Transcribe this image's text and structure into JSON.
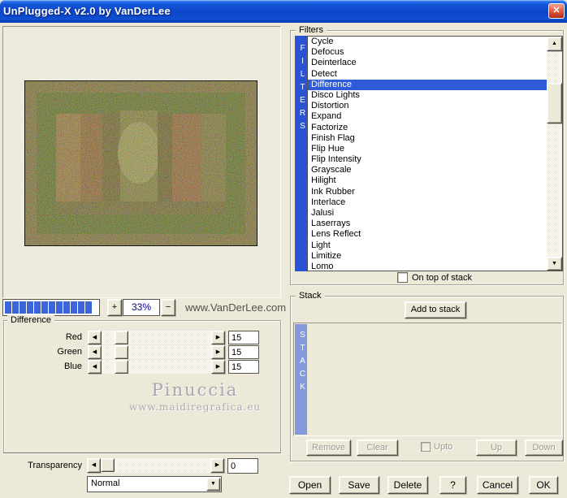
{
  "window": {
    "title": "UnPlugged-X v2.0 by VanDerLee"
  },
  "icons": {
    "close": "✕",
    "left_arrow": "◀",
    "right_arrow": "▶",
    "up_arrow": "▲",
    "down_arrow": "▼",
    "dropdown_arrow": "▼"
  },
  "preview": {
    "zoom_in": "+",
    "zoom_out": "−",
    "zoom_level": "33%",
    "website": "www.VanDerLee.com"
  },
  "filters": {
    "group_label": "Filters",
    "side_label": "FILTERS",
    "selected": "Difference",
    "items": [
      "Cycle",
      "Defocus",
      "Deinterlace",
      "Detect",
      "Difference",
      "Disco Lights",
      "Distortion",
      "Expand",
      "Factorize",
      "Finish Flag",
      "Flip Hue",
      "Flip Intensity",
      "Grayscale",
      "Hilight",
      "Ink Rubber",
      "Interlace",
      "Jalusi",
      "Laserrays",
      "Lens Reflect",
      "Light",
      "Limitize",
      "Lomo"
    ],
    "on_top_label": "On top of stack",
    "on_top_checked": false
  },
  "difference": {
    "group_label": "Difference",
    "rows": [
      {
        "label": "Red",
        "value": "15"
      },
      {
        "label": "Green",
        "value": "15"
      },
      {
        "label": "Blue",
        "value": "15"
      }
    ]
  },
  "watermark": {
    "name": "Pinuccia",
    "url": "www.maidiregrafica.eu"
  },
  "transparency": {
    "label": "Transparency",
    "value": "0",
    "blend_mode": "Normal"
  },
  "stack": {
    "group_label": "Stack",
    "side_label": "STACK",
    "add_button": "Add to stack",
    "remove_button": "Remove",
    "clear_button": "Clear",
    "upto_label": "Upto",
    "upto_checked": false,
    "up_button": "Up",
    "down_button": "Down"
  },
  "footer": {
    "open": "Open",
    "save": "Save",
    "delete": "Delete",
    "help": "?",
    "cancel": "Cancel",
    "ok": "OK"
  },
  "colors": {
    "window_bg": "#ECE9D8",
    "titlebar_blue": "#0D45C8",
    "selection_blue": "#2E5BD8",
    "filters_bar_blue": "#2A52D4",
    "stack_bar_blue": "#8498DC",
    "progress_segment_blue": "#3A64D8",
    "zoom_text_navy": "#000080"
  }
}
